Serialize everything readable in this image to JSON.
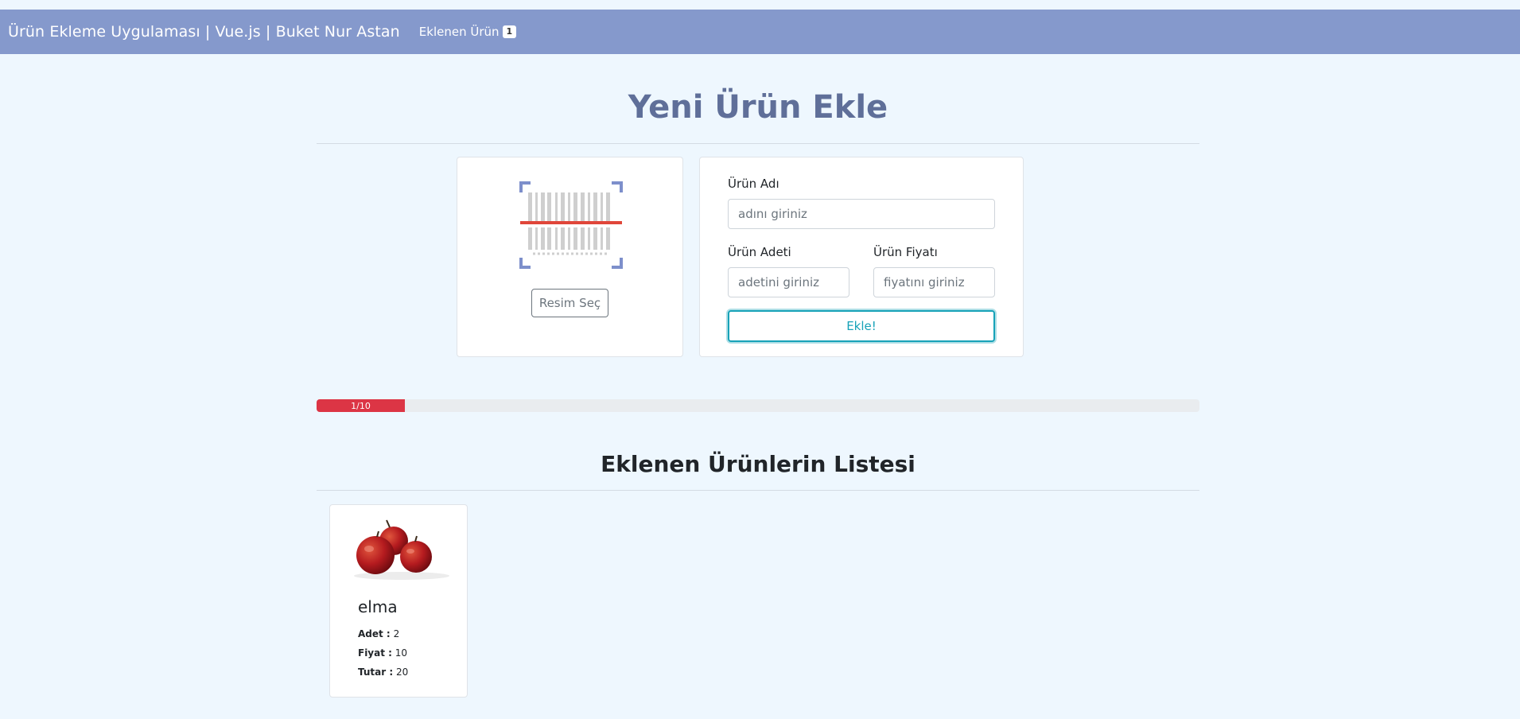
{
  "header": {
    "brand": "Ürün Ekleme Uygulaması | Vue.js | Buket Nur Astan",
    "count_label": "Eklenen Ürün",
    "count_value": "1"
  },
  "form_section": {
    "title": "Yeni Ürün Ekle",
    "image_button": "Resim Seç",
    "name_label": "Ürün Adı",
    "name_placeholder": "adını giriniz",
    "quantity_label": "Ürün Adeti",
    "quantity_placeholder": "adetini giriniz",
    "price_label": "Ürün Fiyatı",
    "price_placeholder": "fiyatını giriniz",
    "submit_label": "Ekle!"
  },
  "progress": {
    "label": "1/10",
    "current": 1,
    "max": 10
  },
  "list_section": {
    "title": "Eklenen Ürünlerin Listesi",
    "products": [
      {
        "name": "elma",
        "quantity_label": "Adet :",
        "quantity": "2",
        "price_label": "Fiyat :",
        "price": "10",
        "total_label": "Tutar :",
        "total": "20"
      }
    ]
  },
  "colors": {
    "navbar": "#8599cc",
    "background": "#eef7fe",
    "title": "#5f6f99",
    "accent": "#17a2b8",
    "progress": "#dc3545",
    "scan_line": "#e0463a",
    "barcode_corner": "#7d8fcb"
  }
}
